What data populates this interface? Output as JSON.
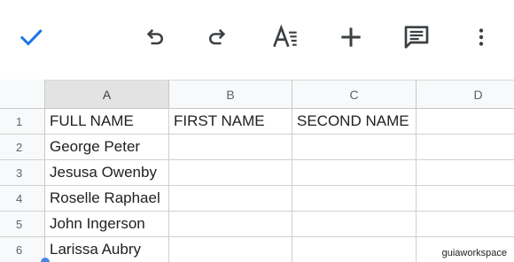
{
  "toolbar": {
    "icons": [
      "check-icon",
      "undo-icon",
      "redo-icon",
      "text-format-icon",
      "add-icon",
      "comment-icon",
      "more-vert-icon"
    ],
    "accent_color": "#1a73e8",
    "icon_color": "#3c4043"
  },
  "columns": [
    "A",
    "B",
    "C",
    "D"
  ],
  "selected_column": "A",
  "rows": [
    "1",
    "2",
    "3",
    "4",
    "5",
    "6"
  ],
  "cells": {
    "A1": "FULL NAME",
    "B1": "FIRST NAME",
    "C1": "SECOND NAME",
    "A2": "George Peter",
    "A3": "Jesusa Owenby",
    "A4": "Roselle Raphael",
    "A5": "John Ingerson",
    "A6": "Larissa Aubry"
  },
  "watermark": "guiaworkspace"
}
